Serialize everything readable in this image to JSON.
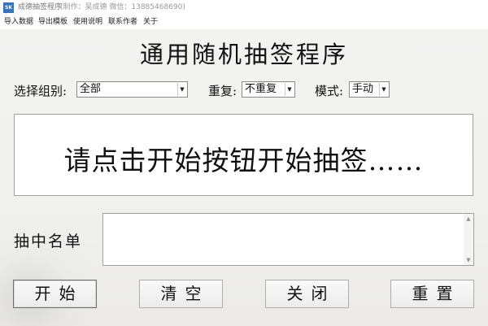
{
  "window": {
    "icon_text": "SK",
    "title": "成德抽签程序",
    "subtitle": "(制作：吴成德 微信：13885468690)"
  },
  "menu": [
    "导入数据",
    "导出模板",
    "使用说明",
    "联系作者",
    "关于"
  ],
  "page_title": "通用随机抽签程序",
  "controls": {
    "group_label": "选择组别:",
    "group_value": "全部",
    "repeat_label": "重复:",
    "repeat_value": "不重复",
    "mode_label": "模式:",
    "mode_value": "手动"
  },
  "display_text": "请点击开始按钮开始抽签……",
  "names_label": "抽中名单",
  "names_value": "",
  "buttons": {
    "start": "开始",
    "clear": "清空",
    "close": "关闭",
    "reset": "重置"
  },
  "icons": {
    "dropdown": "chevron-down-icon",
    "scroll_up": "scroll-up-icon",
    "scroll_down": "scroll-down-icon"
  }
}
